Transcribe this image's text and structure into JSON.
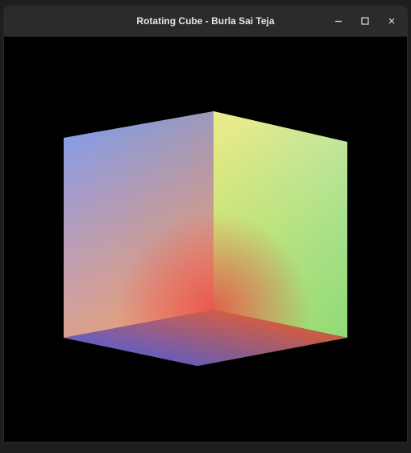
{
  "window": {
    "title": "Rotating Cube - Burla Sai Teja",
    "controls": [
      {
        "name": "minimize",
        "icon": "minimize-icon"
      },
      {
        "name": "maximize",
        "icon": "maximize-icon"
      },
      {
        "name": "close",
        "icon": "close-icon"
      }
    ]
  },
  "scene": {
    "background": "#000000",
    "vertex_colors": {
      "red": "#e84b4b",
      "green": "#4fd44f",
      "blue": "#5a4ae0",
      "yellow": "#e8e84b"
    }
  }
}
